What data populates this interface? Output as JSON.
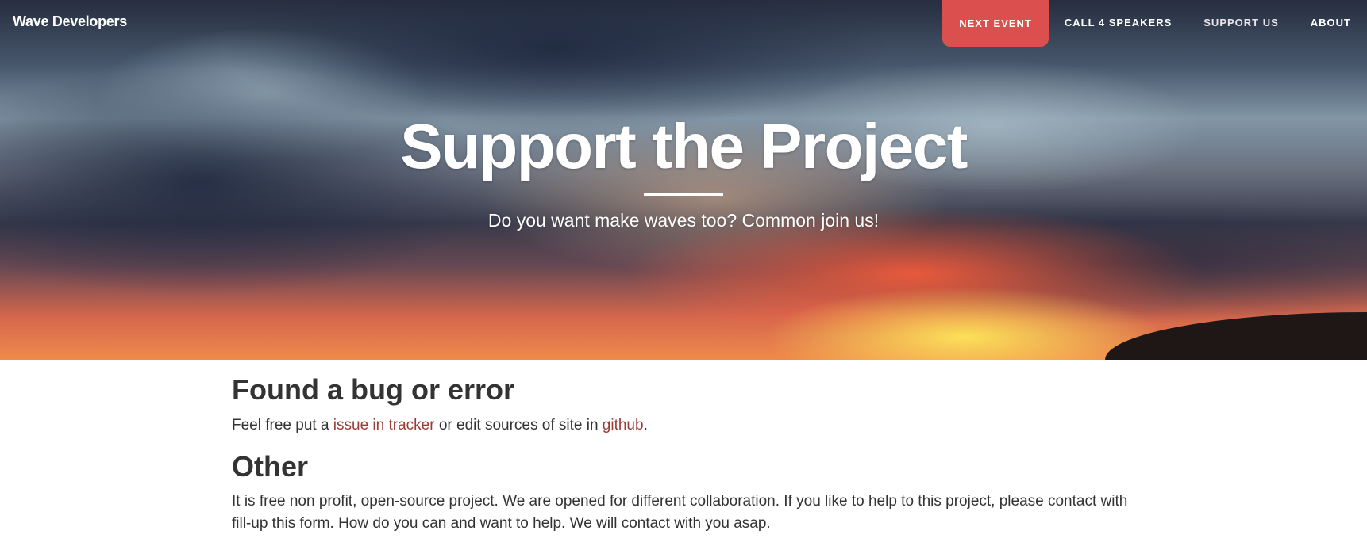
{
  "nav": {
    "brand": "Wave Developers",
    "links": [
      {
        "label": "NEXT EVENT",
        "active": true
      },
      {
        "label": "CALL 4 SPEAKERS",
        "active": false
      },
      {
        "label": "SUPPORT US",
        "active": false
      },
      {
        "label": "ABOUT",
        "active": false
      }
    ]
  },
  "hero": {
    "title": "Support the Project",
    "subtitle": "Do you want make waves too? Common join us!"
  },
  "sections": [
    {
      "heading": "Found a bug or error",
      "text_before": "Feel free put a ",
      "link1": "issue in tracker",
      "text_middle": " or edit sources of site in ",
      "link2": "github",
      "text_after": "."
    },
    {
      "heading": "Other",
      "text": "It is free non profit, open-source project. We are opened for different collaboration. If you like to help to this project, please contact with fill-up this form. How do you can and want to help. We will contact with you asap."
    }
  ],
  "colors": {
    "accent": "#dc4f4f",
    "link": "#9b3b36",
    "text": "#333333"
  }
}
